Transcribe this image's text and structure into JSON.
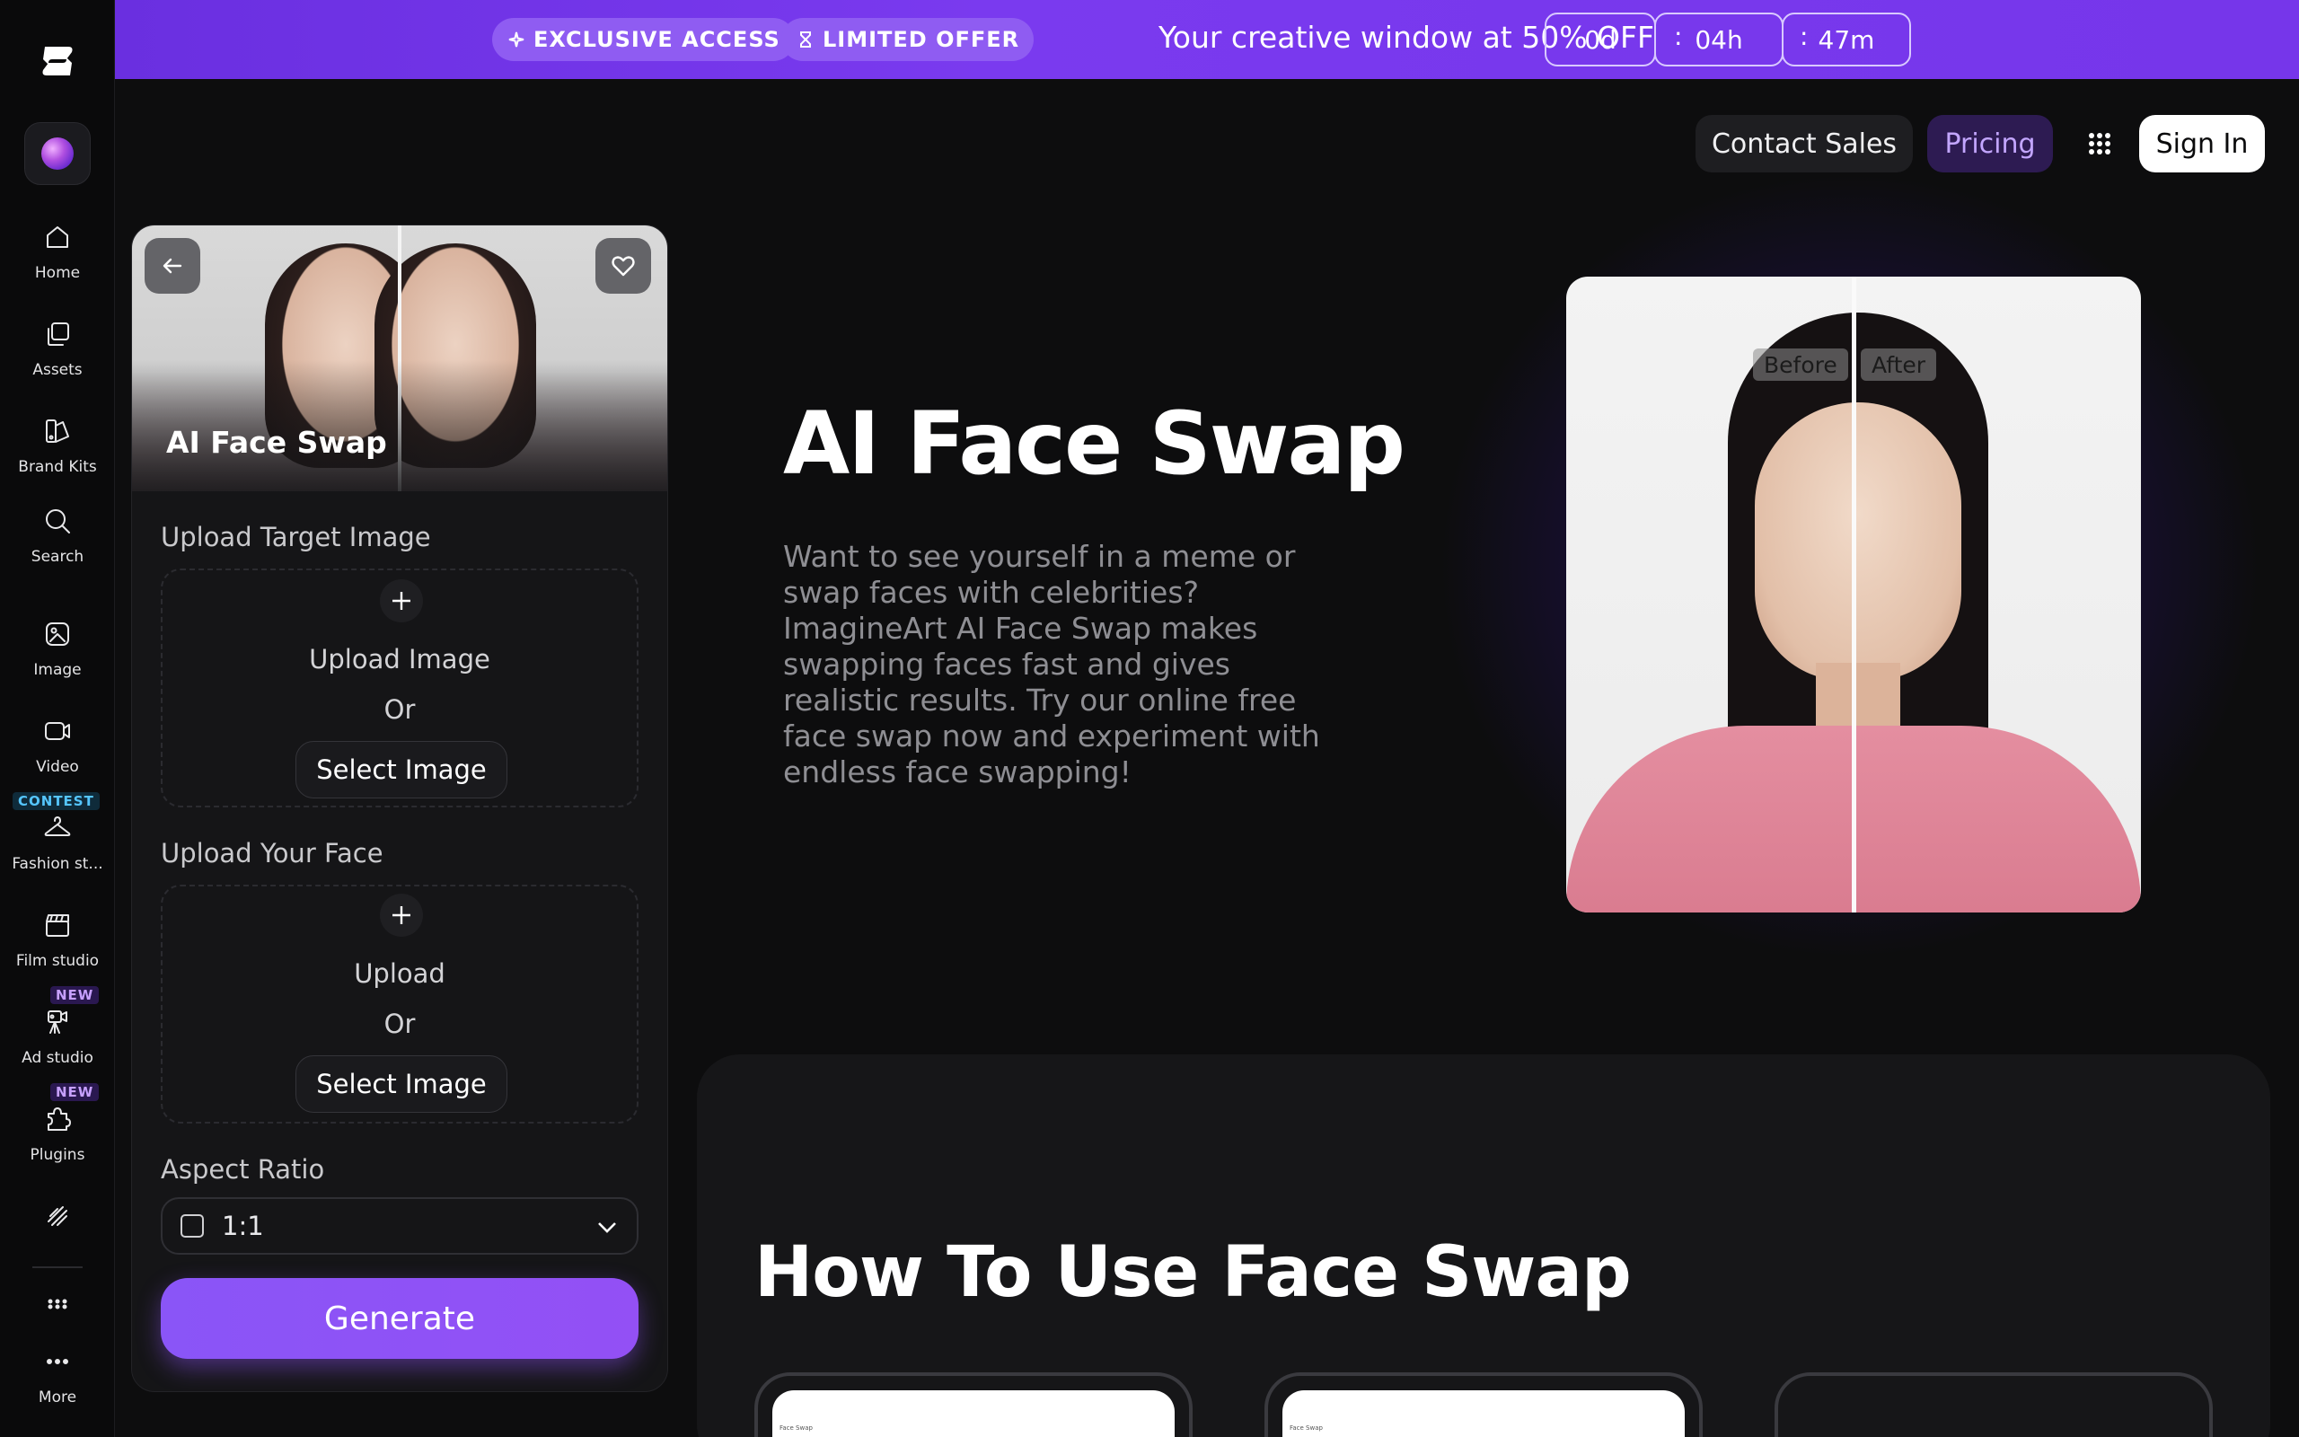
{
  "banner": {
    "pill1": "EXCLUSIVE ACCESS",
    "pill2": "LIMITED OFFER",
    "text": "Your creative window at 50% OFF",
    "days": "0d",
    "hours": "04h",
    "minutes": "47m",
    "separator": ":"
  },
  "sidebar": {
    "items": [
      {
        "label": "Home"
      },
      {
        "label": "Assets"
      },
      {
        "label": "Brand Kits"
      },
      {
        "label": "Search"
      },
      {
        "label": "Image"
      },
      {
        "label": "Video"
      },
      {
        "label": "Fashion st..."
      },
      {
        "label": "Film studio"
      },
      {
        "label": "Ad studio"
      },
      {
        "label": "Plugins"
      },
      {
        "label": "More"
      }
    ],
    "badges": {
      "contest": "CONTEST",
      "new": "NEW"
    }
  },
  "header": {
    "contact": "Contact Sales",
    "pricing": "Pricing",
    "signin": "Sign In"
  },
  "panel": {
    "title": "AI Face Swap",
    "target_label": "Upload Target Image",
    "target_upload": "Upload Image",
    "or": "Or",
    "select": "Select  Image",
    "face_label": "Upload Your Face",
    "face_upload": "Upload",
    "aspect_label": "Aspect Ratio",
    "aspect_value": "1:1",
    "generate": "Generate"
  },
  "hero": {
    "title": "AI Face Swap",
    "description": "Want to see yourself in a meme or swap faces with celebrities? ImagineArt AI Face Swap makes swapping faces fast and gives realistic results. Try our online free face swap now and experiment with endless face swapping!",
    "before": "Before",
    "after": "After"
  },
  "howto": {
    "title": "How To Use Face Swap",
    "card_caption": "Face Swap"
  },
  "colors": {
    "accent": "#8a55f7",
    "banner": "#7636ea",
    "background": "#0d0d0e"
  }
}
